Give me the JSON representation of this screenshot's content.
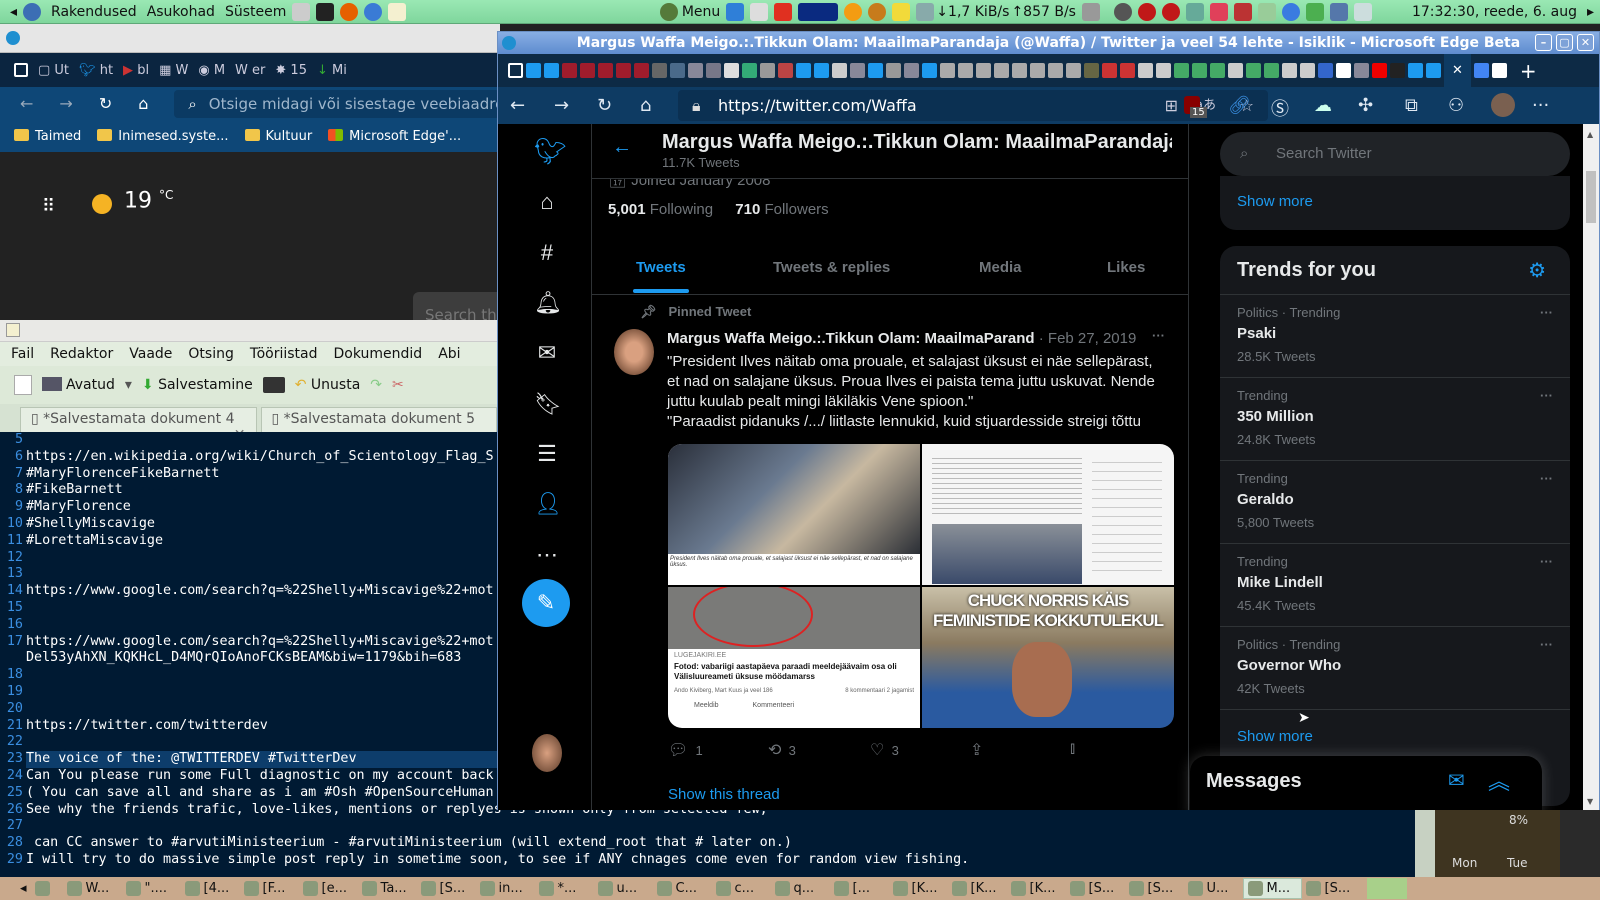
{
  "panel": {
    "menus": [
      "Rakendused",
      "Asukohad",
      "Süsteem"
    ],
    "menu_label": "Menu",
    "net_down": "1,7 KiB/s",
    "net_up": "857 B/s",
    "clock": "17:32:30, reede,  6. aug"
  },
  "back_browser": {
    "tabs": [
      "Ut",
      "ht",
      "bl",
      "W",
      "M",
      "er",
      "15",
      "Mi"
    ],
    "address_placeholder": "Otsige midagi või sisestage veebiaadress",
    "bookmarks": [
      "Taimed",
      "Inimesed.syste...",
      "Kultuur",
      "Microsoft Edge'..."
    ],
    "temperature": "19",
    "temp_unit": "°C",
    "search_partial": "Search the"
  },
  "editor": {
    "menu": [
      "Fail",
      "Redaktor",
      "Vaade",
      "Otsing",
      "Tööriistad",
      "Dokumendid",
      "Abi"
    ],
    "toolbar": {
      "open": "Avatud",
      "save": "Salvestamine",
      "undo": "Unusta"
    },
    "tabs": [
      "*Salvestamata dokument 4",
      "*Salvestamata dokument 5"
    ],
    "lines": [
      {
        "n": "5",
        "t": ""
      },
      {
        "n": "6",
        "t": "https://en.wikipedia.org/wiki/Church_of_Scientology_Flag_S"
      },
      {
        "n": "7",
        "t": "#MaryFlorenceFikeBarnett"
      },
      {
        "n": "8",
        "t": "#FikeBarnett"
      },
      {
        "n": "9",
        "t": "#MaryFlorence"
      },
      {
        "n": "10",
        "t": "#ShellyMiscavige"
      },
      {
        "n": "11",
        "t": "#LorettaMiscavige"
      },
      {
        "n": "12",
        "t": ""
      },
      {
        "n": "13",
        "t": ""
      },
      {
        "n": "14",
        "t": "https://www.google.com/search?q=%22Shelly+Miscavige%22+mot"
      },
      {
        "n": "15",
        "t": ""
      },
      {
        "n": "16",
        "t": ""
      },
      {
        "n": "17",
        "t": "https://www.google.com/search?q=%22Shelly+Miscavige%22+mot"
      },
      {
        "n": "",
        "t": "Del53yAhXN_KQKHcL_D4MQrQIoAnoFCKsBEAM&biw=1179&bih=683"
      },
      {
        "n": "18",
        "t": ""
      },
      {
        "n": "19",
        "t": ""
      },
      {
        "n": "20",
        "t": ""
      },
      {
        "n": "21",
        "t": "https://twitter.com/twitterdev"
      },
      {
        "n": "22",
        "t": ""
      },
      {
        "n": "23",
        "t": "The voice of the: @TWITTERDEV #TwitterDev",
        "sel": true
      },
      {
        "n": "24",
        "t": "Can You please run some Full diagnostic on my account back"
      },
      {
        "n": "25",
        "t": "( You can save all and share as i am #Osh #OpenSourceHuman"
      },
      {
        "n": "26",
        "t": "See why the friends trafic, love-likes, mentions or replyes is shown only from selected few,"
      },
      {
        "n": "27",
        "t": ""
      },
      {
        "n": "28",
        "t": " can CC answer to #arvutiMinisteerium - #arvutiMinisteerium (will extend_root that # later on.)"
      },
      {
        "n": "29",
        "t": "I will try to do massive simple post reply in sometime soon, to see if ANY chnages come even for random view fishing."
      }
    ]
  },
  "edge": {
    "title": "Margus Waffa Meigo.:.Tikkun Olam: MaailmaParandaja (@Waffa) / Twitter ja veel 54 lehte - Isiklik - Microsoft Edge Beta",
    "url": "https://twitter.com/Waffa",
    "ext_badge": "15"
  },
  "twitter": {
    "profile_name": "Margus Waffa Meigo.:.Tikkun Olam: MaailmaParandaja",
    "tweet_count": "11.7K Tweets",
    "joined": "Joined January 2008",
    "following_count": "5,001",
    "following_label": "Following",
    "followers_count": "710",
    "followers_label": "Followers",
    "tabs": [
      "Tweets",
      "Tweets & replies",
      "Media",
      "Likes"
    ],
    "pinned_label": "Pinned Tweet",
    "tweet": {
      "author": "Margus Waffa Meigo.:.Tikkun Olam: MaailmaParand",
      "date": "· Feb 27, 2019",
      "text": [
        "\"President Ilves näitab oma prouale, et salajast üksust ei näe  sellepärast,",
        "et nad on salajane üksus. Proua Ilves ei paista tema juttu  uskuvat. Nende",
        "juttu kuulab pealt mingi läkiläkis Vene spioon.\"",
        "\"Paraadist pidanuks /.../ liitlaste lennukid, kuid stjuardesside streigi tõttu"
      ],
      "img_caption": "President Ilves näitab oma prouale, et salajast üksust ei näe sellepärast, et nad on salajane üksus.",
      "link_source": "LUGEJAKIRI.EE",
      "link_title": "Fotod: vabariigi aastapäeva paraadi meeldejäävaim osa oli Välisluureameti üksuse möödamarss",
      "link_reactions": "Ando Kiviberg, Mart Kuus ja veel 186",
      "link_comments": "8 kommentaari  2 jagamist",
      "link_like": "Meeldib",
      "link_comment": "Kommenteeri",
      "meme_text": "CHUCK NORRIS KÄIS FEMINISTIDE KOKKUTULEKUL",
      "replies": "1",
      "retweets": "3",
      "likes": "3",
      "show_thread": "Show this thread"
    },
    "search_placeholder": "Search Twitter",
    "show_more": "Show more",
    "trends_title": "Trends for you",
    "trends": [
      {
        "context": "Politics · Trending",
        "name": "Psaki",
        "count": "28.5K Tweets"
      },
      {
        "context": "Trending",
        "name": "350 Million",
        "count": "24.8K Tweets"
      },
      {
        "context": "Trending",
        "name": "Geraldo",
        "count": "5,800 Tweets"
      },
      {
        "context": "Trending",
        "name": "Mike Lindell",
        "count": "45.4K Tweets"
      },
      {
        "context": "Politics · Trending",
        "name": "Governor Who",
        "count": "42K Tweets"
      }
    ],
    "messages": "Messages"
  },
  "widget": {
    "percent": "8%",
    "days": [
      "Mon",
      "Tue"
    ]
  },
  "taskbar": [
    "W...",
    "\"....",
    "[4...",
    "[F...",
    "[e...",
    "Ta...",
    "[S...",
    "in...",
    "*...",
    "u...",
    "C...",
    "c...",
    "q...",
    "[...",
    "[K...",
    "[K...",
    "[K...",
    "[S...",
    "[S...",
    "U...",
    "M...",
    "[S..."
  ],
  "taskbar_active": 20
}
